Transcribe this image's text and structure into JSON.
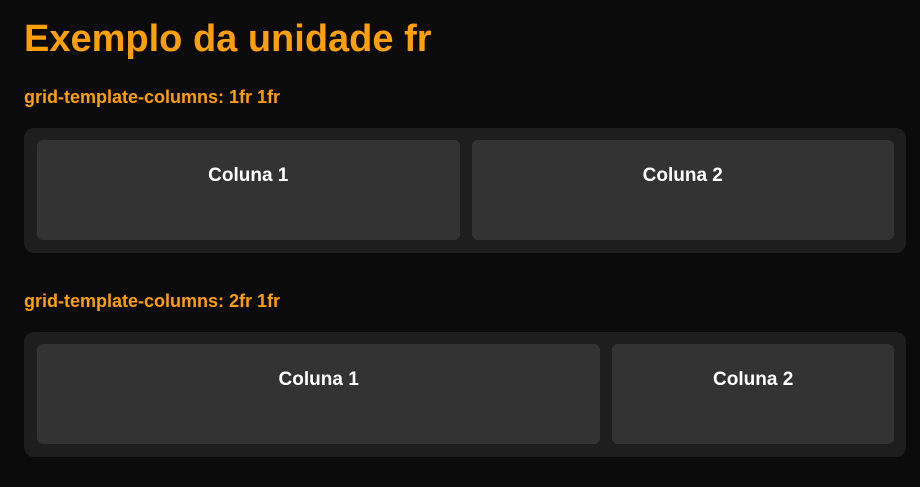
{
  "page": {
    "title": "Exemplo da unidade fr"
  },
  "sections": [
    {
      "heading": "grid-template-columns: 1fr 1fr",
      "cells": [
        "Coluna 1",
        "Coluna 2"
      ]
    },
    {
      "heading": "grid-template-columns: 2fr 1fr",
      "cells": [
        "Coluna 1",
        "Coluna 2"
      ]
    }
  ],
  "colors": {
    "background": "#0b0b0b",
    "accent": "#ff9f0a",
    "container": "#1e1e1e",
    "cell": "#333333",
    "cell_text": "#ffffff"
  }
}
